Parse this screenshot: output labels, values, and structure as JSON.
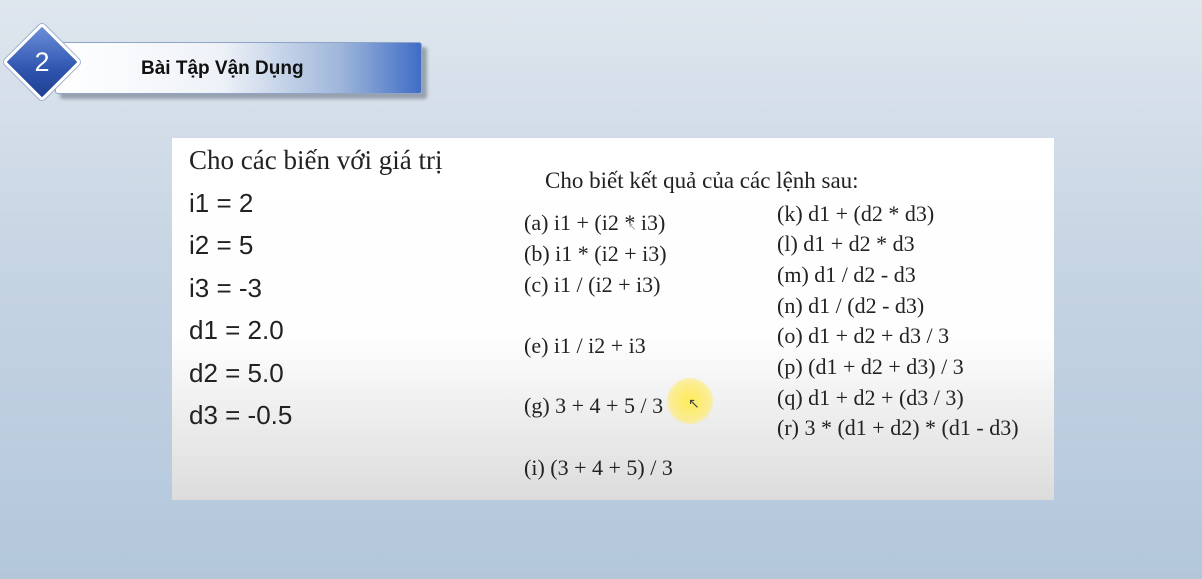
{
  "header": {
    "number": "2",
    "title": "Bài Tập Vận Dụng"
  },
  "slide": {
    "left_title": "Cho các biến với giá trị",
    "variables": [
      "i1 = 2",
      "i2 = 5",
      "i3 = -3",
      "d1 = 2.0",
      "d2 = 5.0",
      "d3 = -0.5"
    ],
    "question_title": "Cho biết kết quả của các lệnh sau:",
    "col1": [
      "(a) i1 + (i2 * i3)",
      "(b) i1 * (i2 + i3)",
      "(c) i1 / (i2 + i3)",
      "(e) i1 / i2 + i3",
      "(g) 3 + 4 + 5 / 3",
      "(i) (3 + 4 + 5) / 3"
    ],
    "col2": [
      "(k) d1 + (d2 * d3)",
      "(l) d1 + d2 * d3",
      "(m) d1 / d2 - d3",
      "(n) d1 / (d2 - d3)",
      "(o) d1 + d2 + d3 / 3",
      "(p) (d1 + d2 + d3) / 3",
      "(q) d1 + d2 + (d3 / 3)",
      "(r) 3 * (d1 + d2) * (d1 - d3)"
    ]
  },
  "icons": {
    "cursor": "mouse-pointer-icon",
    "cursor_glyph": "↖",
    "cursor_glyph_small": "↖"
  },
  "colors": {
    "badge": "#2f55b0",
    "header_accent": "#3f6dc6",
    "highlight": "#ffeb50"
  }
}
